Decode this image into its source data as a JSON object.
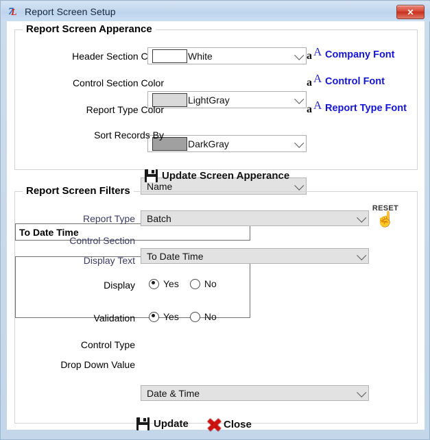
{
  "window": {
    "title": "Report Screen Setup",
    "app_icon": "zl-logo-icon",
    "close_button_label": "✕"
  },
  "appearance": {
    "legend": "Report Screen Apperance",
    "rows": [
      {
        "label": "Header Section Color",
        "value": "White",
        "swatch_color": "#ffffff"
      },
      {
        "label": "Control Section Color",
        "value": "LightGray",
        "swatch_color": "#d9d9d9"
      },
      {
        "label": "Report Type Color",
        "value": "DarkGray",
        "swatch_color": "#a0a0a0"
      }
    ],
    "sort": {
      "label": "Sort Records By",
      "value": "Name"
    },
    "font_links": [
      {
        "label": "Company Font"
      },
      {
        "label": "Control Font"
      },
      {
        "label": "Report Type Font"
      }
    ],
    "update_button": "Update Screen Apperance"
  },
  "filters": {
    "legend": "Report Screen Filters",
    "reset": {
      "label": "RESET",
      "icon": "hand-pointer-icon"
    },
    "report_type": {
      "label": "Report Type",
      "value": "Batch"
    },
    "control_section": {
      "label": "Control Section",
      "value": "To Date Time"
    },
    "display_text": {
      "label": "Display Text",
      "value": "To Date Time"
    },
    "display": {
      "label": "Display",
      "yes": "Yes",
      "no": "No",
      "selected": "Yes"
    },
    "validation": {
      "label": "Validation",
      "yes": "Yes",
      "no": "No",
      "selected": "Yes"
    },
    "control_type": {
      "label": "Control Type",
      "value": "Date & Time"
    },
    "drop_down_value": {
      "label": "Drop Down Value",
      "value": ""
    },
    "update_button": "Update",
    "close_button": "Close"
  },
  "colors": {
    "accent_blue": "#1414d6",
    "label_navy": "#3b3b63",
    "titlebar": "#c3d8ee",
    "close_red": "#c8301d"
  }
}
